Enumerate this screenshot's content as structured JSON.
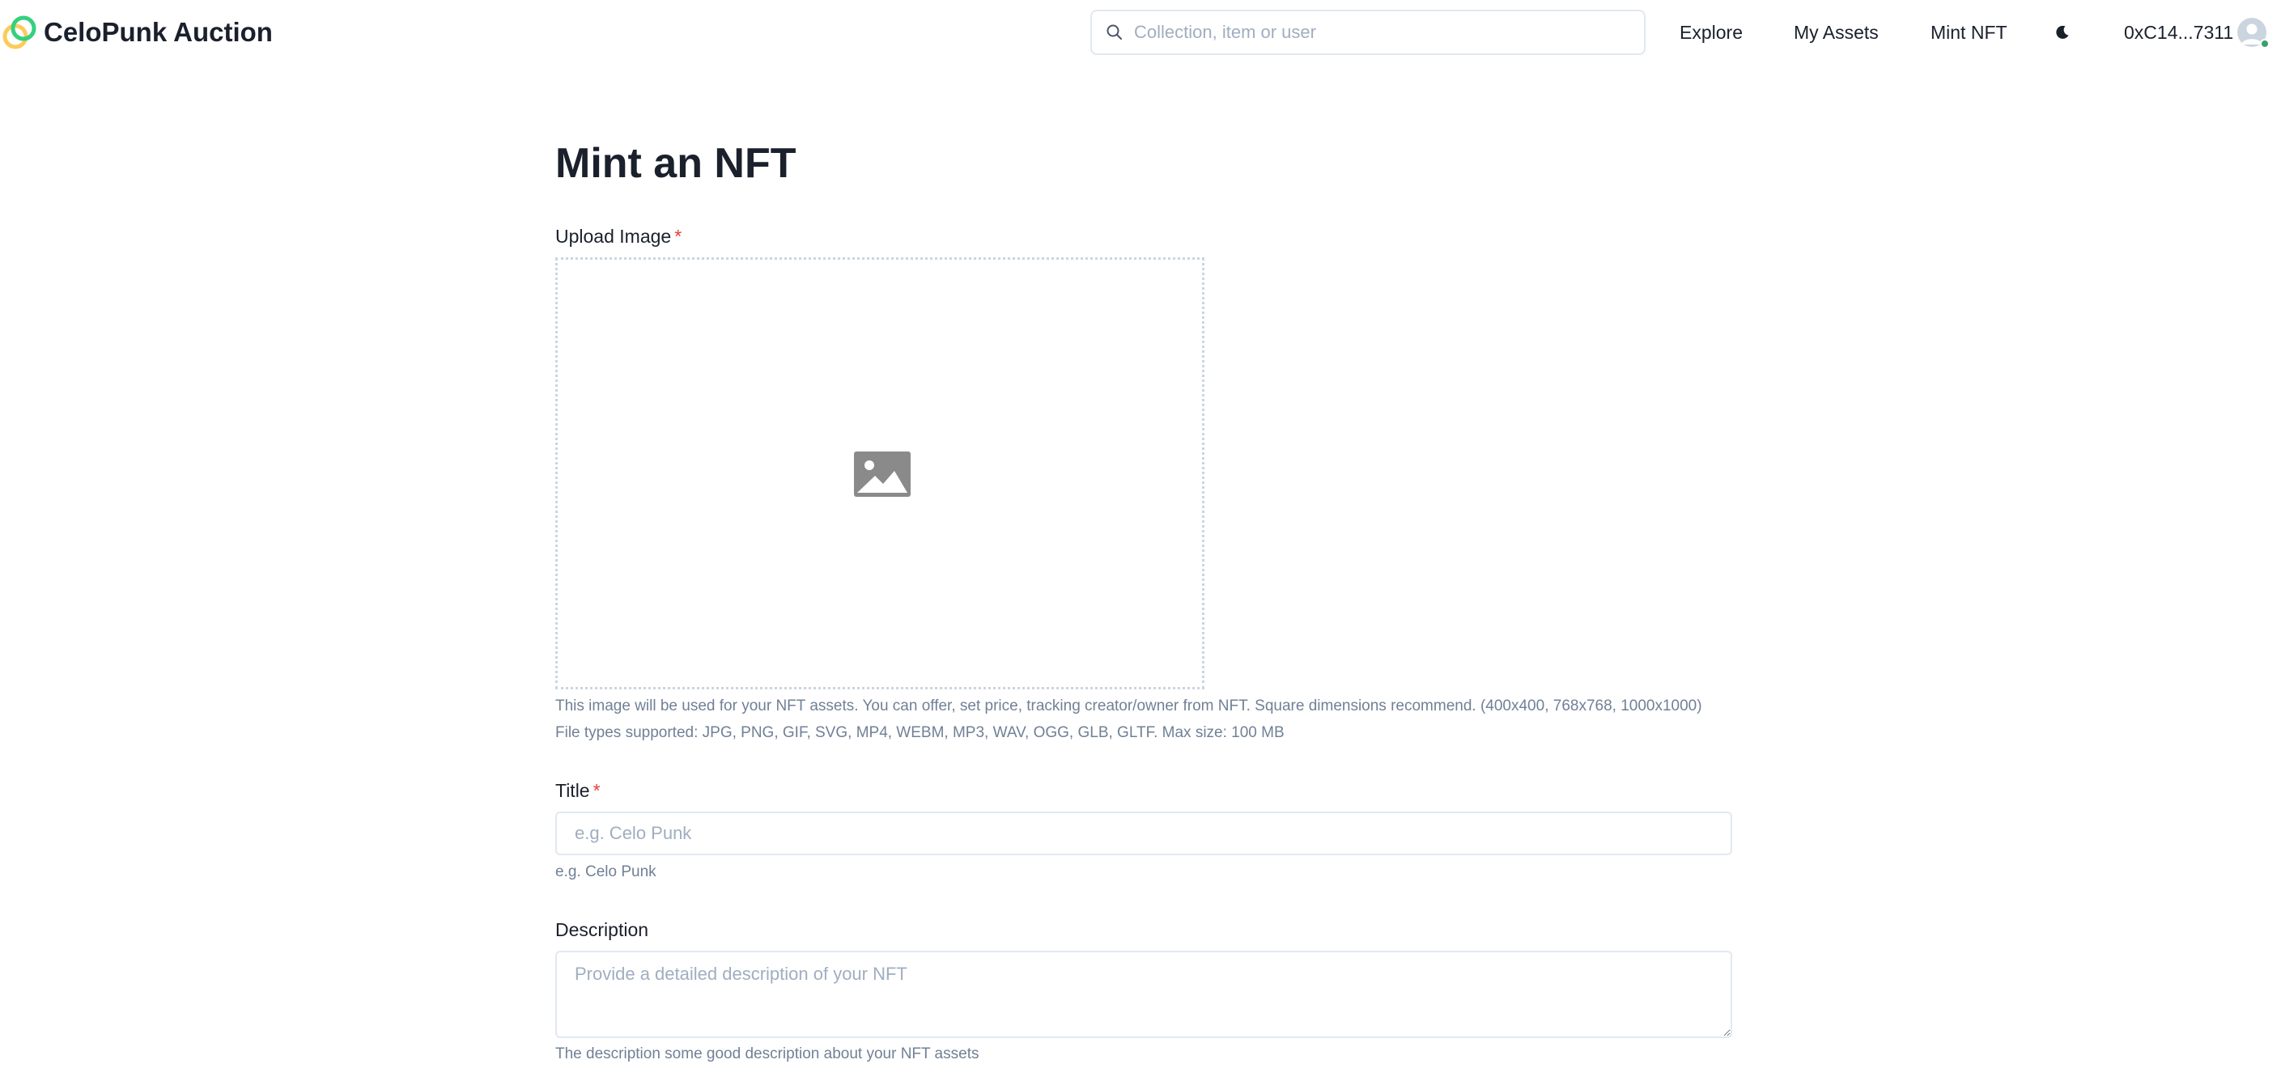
{
  "header": {
    "brand": "CeloPunk Auction",
    "search_placeholder": "Collection, item or user",
    "nav": {
      "explore": "Explore",
      "my_assets": "My Assets",
      "mint_nft": "Mint NFT"
    },
    "wallet_address": "0xC14...7311"
  },
  "form": {
    "page_title": "Mint an NFT",
    "upload": {
      "label": "Upload Image",
      "required_mark": "*",
      "helper_line1": "This image will be used for your NFT assets. You can offer, set price, tracking creator/owner from NFT. Square dimensions recommend. (400x400, 768x768, 1000x1000)",
      "helper_line2": "File types supported: JPG, PNG, GIF, SVG, MP4, WEBM, MP3, WAV, OGG, GLB, GLTF. Max size: 100 MB"
    },
    "title": {
      "label": "Title",
      "required_mark": "*",
      "placeholder": "e.g. Celo Punk",
      "helper": "e.g. Celo Punk"
    },
    "description": {
      "label": "Description",
      "placeholder": "Provide a detailed description of your NFT",
      "helper": "The description some good description about your NFT assets"
    }
  },
  "icons": {
    "logo": "celo-logo-icon",
    "search": "search-icon",
    "theme": "moon-icon",
    "avatar": "user-avatar-icon",
    "upload": "image-placeholder-icon"
  },
  "colors": {
    "required": "#e53e3e",
    "helper_text": "#718096",
    "online_badge": "#38a169",
    "logo_yellow": "#fbcc5c",
    "logo_green": "#35d07f"
  }
}
